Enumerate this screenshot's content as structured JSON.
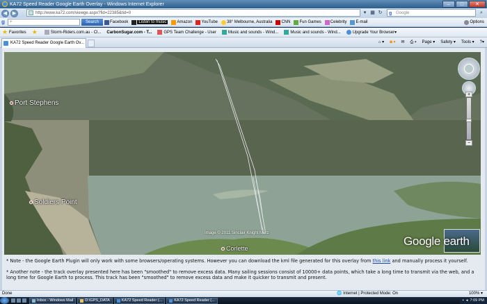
{
  "window": {
    "title": "KA72 Speed Reader Google Earth Overlay - Windows Internet Explorer",
    "buttons": {
      "minimize": "–",
      "maximize": "□",
      "close": "✕"
    }
  },
  "address": {
    "url": "http://www.ka72.com/viewge.aspx?fid=22385&tid=0",
    "search_placeholder": "Google"
  },
  "toolbar": {
    "search_placeholder": "+",
    "search_label": "Search",
    "items": [
      "Facebook",
      "Listen to music",
      "Amazon",
      "YouTube",
      "38° Melbourne, Australia",
      "CNN",
      "Fun Games",
      "Celebrity",
      "E-mail"
    ],
    "options": "Options"
  },
  "favorites": {
    "label": "Favorites",
    "items": [
      "Storm-Riders.com.au - Cl...",
      "CarbonSugar.com - T...",
      "GPS Team Challenge - User",
      "Music and sounds - Wind...",
      "Music and sounds - Wind...",
      "Upgrade Your Browser"
    ]
  },
  "tab": {
    "label": "KA72 Speed Reader Google Earth Ov..."
  },
  "command_bar": [
    "Page",
    "Safety",
    "Tools"
  ],
  "map": {
    "places": [
      "Port Stephens",
      "Soldiers Point"
    ],
    "copyright": "Image © 2011 Sinclair Knight Merz",
    "town": "Corlette",
    "logo": "Google earth"
  },
  "notes": {
    "note1_pre": "* Note - the Google Earth Plugin will only work with some browsers/operating systems. However you can download the kml file generated for this overlay from ",
    "note1_link": "this link",
    "note1_post": " and manually process it yourself.",
    "note2": "* Another note - the track overlay presented here has been \"smoothed\" to remove excess data. Many sailing sessions consist of 10000+ data points, which take a long time to transmit via the web, and a long time for Google Earth to process. This track has been \"smoothed\" to remove excess data and make it quicker to transmit and present."
  },
  "status": {
    "left": "Done",
    "zone": "Internet | Protected Mode: On",
    "zoom": "100%"
  },
  "taskbar": {
    "items": [
      "Inbox - Windows Mail",
      "D:\\GPS_DATA",
      "KA72 Speed Reader (...",
      "KA72 Speed Reader (..."
    ],
    "clock": "7:09 PM"
  }
}
